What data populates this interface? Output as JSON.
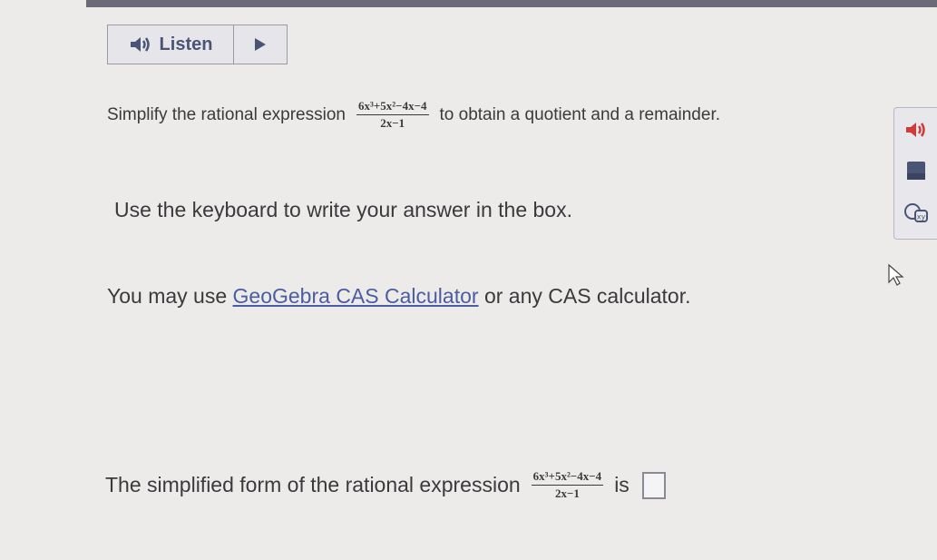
{
  "listen": {
    "label": "Listen"
  },
  "question": {
    "prefix": "Simplify the rational expression",
    "numerator": "6x³+5x²−4x−4",
    "denominator": "2x−1",
    "suffix": "to obtain a quotient and a remainder."
  },
  "instruction": "Use the keyboard to write your answer in the box.",
  "calculator_note": {
    "prefix": "You may use",
    "link": "GeoGebra CAS Calculator",
    "suffix": "or any CAS calculator."
  },
  "answer_line": {
    "prefix": "The simplified form of the rational expression",
    "numerator": "6x³+5x²−4x−4",
    "denominator": "2x−1",
    "connector": "is",
    "value": ""
  },
  "colors": {
    "accent": "#4a5575",
    "link": "#4b5ca0",
    "speaker_red": "#d23a3a"
  },
  "icons": [
    "speaker-icon",
    "play-icon",
    "read-aloud-icon",
    "notepad-icon",
    "math-tools-icon",
    "cursor-icon"
  ]
}
